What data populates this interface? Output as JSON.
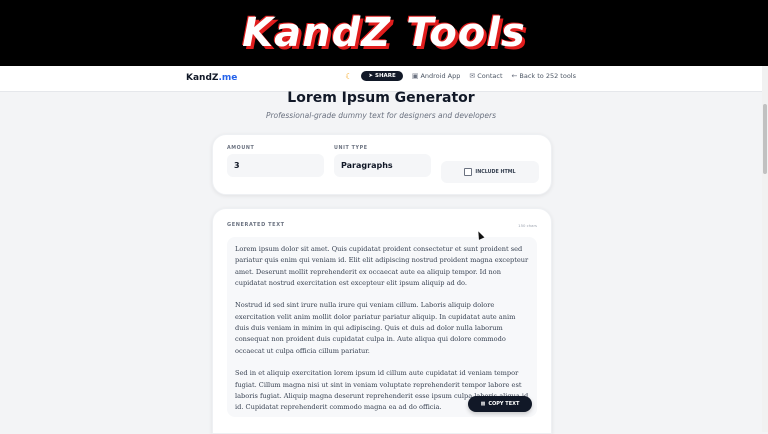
{
  "banner": {
    "title": "KandZ Tools"
  },
  "header": {
    "brand_main": "KandZ",
    "brand_suffix": ".me",
    "share_label": "SHARE",
    "android_label": "Android App",
    "contact_label": "Contact",
    "back_label": "Back to 252 tools"
  },
  "page": {
    "title": "Lorem Ipsum Generator",
    "subtitle": "Professional-grade dummy text for designers and developers"
  },
  "controls": {
    "amount_label": "AMOUNT",
    "amount_value": "3",
    "unit_label": "UNIT TYPE",
    "unit_value": "Paragraphs",
    "include_html_label": "INCLUDE HTML",
    "include_html_checked": false
  },
  "output": {
    "label": "GENERATED TEXT",
    "count": "150 chars",
    "paragraphs": [
      " Lorem ipsum dolor sit amet. Quis cupidatat proident consectetur et sunt proident sed pariatur quis enim qui veniam id. Elit elit adipiscing nostrud proident magna excepteur amet. Deserunt mollit reprehenderit ex occaecat aute ea aliquip tempor. Id non cupidatat nostrud exercitation est excepteur elit ipsum aliquip ad do.",
      "Nostrud id sed sint irure nulla irure qui veniam cillum. Laboris aliquip dolore exercitation velit anim mollit dolor pariatur pariatur aliquip. In cupidatat aute anim duis duis veniam in minim in qui adipiscing. Quis et duis ad dolor nulla laborum consequat non proident duis cupidatat culpa in. Aute aliqua qui dolore commodo occaecat ut culpa officia cillum pariatur.",
      "Sed in et aliquip exercitation lorem ipsum id cillum aute cupidatat id veniam tempor fugiat. Cillum magna nisi ut sint in veniam voluptate reprehenderit tempor labore est laboris fugiat. Aliquip magna deserunt reprehenderit esse ipsum culpa laboris aliqua id id. Cupidatat reprehenderit commodo magna ea ad do officia."
    ],
    "copy_label": "COPY TEXT"
  },
  "icons": {
    "moon": "moon-icon",
    "share": "share-icon",
    "android": "android-icon",
    "contact": "mail-icon",
    "back": "arrow-left-icon",
    "copy": "clipboard-icon"
  },
  "colors": {
    "brand_accent": "#2563eb",
    "dark_button": "#111827",
    "banner_outline": "#e11d1d"
  }
}
